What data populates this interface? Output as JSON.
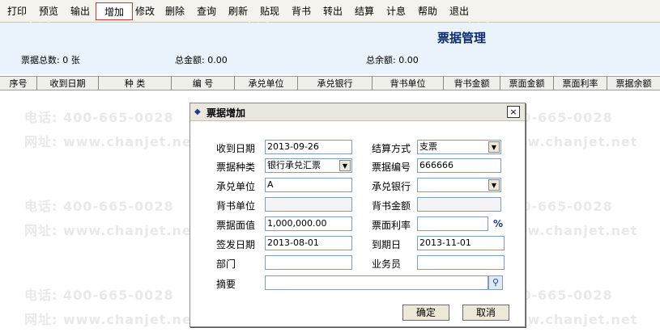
{
  "toolbar": {
    "items": [
      {
        "label": "打印"
      },
      {
        "label": "预览"
      },
      {
        "label": "输出"
      },
      {
        "label": "增加"
      },
      {
        "label": "修改"
      },
      {
        "label": "删除"
      },
      {
        "label": "查询"
      },
      {
        "label": "刷新"
      },
      {
        "label": "贴现"
      },
      {
        "label": "背书"
      },
      {
        "label": "转出"
      },
      {
        "label": "结算"
      },
      {
        "label": "计息"
      },
      {
        "label": "帮助"
      },
      {
        "label": "退出"
      }
    ],
    "active": "增加"
  },
  "header": {
    "title": "票据管理",
    "total_count": "票据总数: 0 张",
    "total_amount": "总金额: 0.00",
    "total_balance": "总余额: 0.00"
  },
  "grid": {
    "columns": [
      "序号",
      "收到日期",
      "种  类",
      "编  号",
      "承兑单位",
      "承兑银行",
      "背书单位",
      "背书金额",
      "票面金额",
      "票面利率",
      "票据余额"
    ]
  },
  "watermark": {
    "phone": "电话: 400-665-0028",
    "site": "网址: www.chanjet.net"
  },
  "dialog": {
    "title": "票据增加",
    "close_glyph": "×",
    "fields": {
      "receive_date": {
        "label": "收到日期",
        "value": "2013-09-26"
      },
      "settle_method": {
        "label": "结算方式",
        "value": "支票"
      },
      "bill_type": {
        "label": "票据种类",
        "value": "银行承兑汇票"
      },
      "bill_no": {
        "label": "票据编号",
        "value": "666666"
      },
      "acceptor": {
        "label": "承兑单位",
        "value": "A"
      },
      "acceptor_bank": {
        "label": "承兑银行",
        "value": ""
      },
      "endorser": {
        "label": "背书单位",
        "value": ""
      },
      "endorse_amount": {
        "label": "背书金额",
        "value": ""
      },
      "face_value": {
        "label": "票据面值",
        "value": "1,000,000.00"
      },
      "face_rate": {
        "label": "票面利率",
        "value": "",
        "unit": "%"
      },
      "issue_date": {
        "label": "签发日期",
        "value": "2013-08-01"
      },
      "due_date": {
        "label": "到期日",
        "value": "2013-11-01"
      },
      "dept": {
        "label": "部门",
        "value": ""
      },
      "clerk": {
        "label": "业务员",
        "value": ""
      },
      "memo": {
        "label": "摘要",
        "value": ""
      }
    },
    "ok_label": "确定",
    "cancel_label": "取消"
  }
}
